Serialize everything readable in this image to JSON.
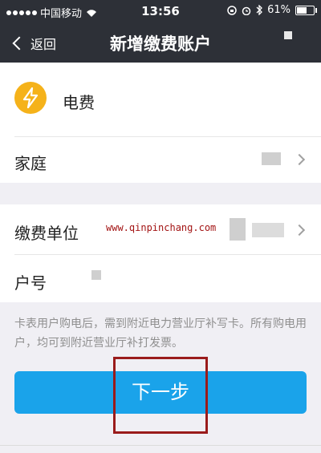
{
  "status_bar": {
    "carrier": "中国移动",
    "time": "13:56",
    "battery_percent": "61%",
    "battery_level": 0.61
  },
  "navbar": {
    "back_label": "返回",
    "title": "新增缴费账户"
  },
  "service": {
    "icon": "lightning-icon",
    "name": "电费",
    "icon_color": "#f5b21a"
  },
  "fields": {
    "group_label": "家庭",
    "payee_label": "缴费单位",
    "account_label": "户号"
  },
  "watermark": "www.qinpinchang.com",
  "notice": "卡表用户购电后，需到附近电力营业厅补写卡。所有购电用户，均可到附近营业厅补打发票。",
  "next_button": {
    "label": "下一步",
    "color": "#1aa3ea"
  },
  "colors": {
    "header_bg": "#2d3037",
    "highlight_border": "#9a1b1b"
  }
}
